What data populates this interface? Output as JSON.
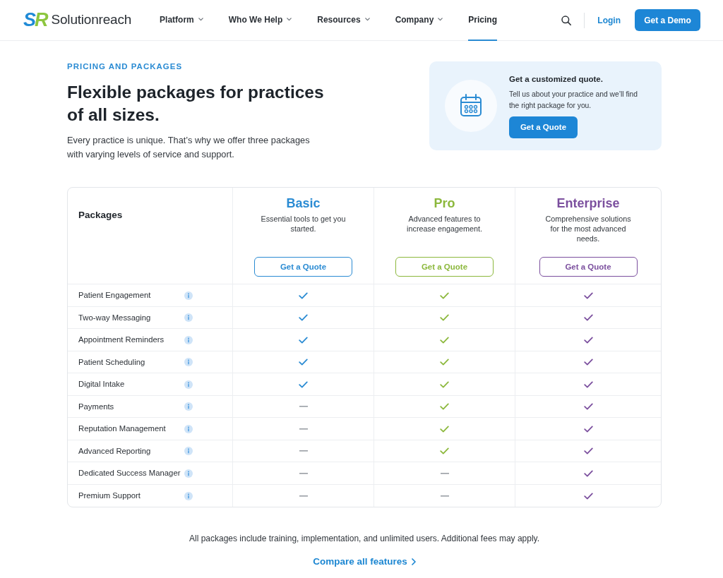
{
  "brand": {
    "mark": [
      "S",
      "R"
    ],
    "name": "Solutionreach"
  },
  "nav": [
    {
      "label": "Platform",
      "dropdown": true,
      "selected": false
    },
    {
      "label": "Who We Help",
      "dropdown": true,
      "selected": false
    },
    {
      "label": "Resources",
      "dropdown": true,
      "selected": false
    },
    {
      "label": "Company",
      "dropdown": true,
      "selected": false
    },
    {
      "label": "Pricing",
      "dropdown": false,
      "selected": true
    }
  ],
  "header_actions": {
    "login": "Login",
    "demo_button": "Get a Demo"
  },
  "hero": {
    "eyebrow": "PRICING AND PACKAGES",
    "title": "Flexible packages for practices of all sizes.",
    "intro": "Every practice is unique. That’s why we offer three packages with varying levels of service and support."
  },
  "quote_card": {
    "title": "Get a customized quote.",
    "text": "Tell us about your practice and we’ll find the right package for you.",
    "button": "Get a Quote"
  },
  "table": {
    "header": "Packages",
    "plans": [
      {
        "name": "Basic",
        "color": "#2a8bd3",
        "description": "Essential tools to get you started.",
        "button": "Get a Quote"
      },
      {
        "name": "Pro",
        "color": "#8cb83c",
        "description": "Advanced features to increase engagement.",
        "button": "Get a Quote"
      },
      {
        "name": "Enterprise",
        "color": "#7b4f9e",
        "description": "Comprehensive solutions for the most advanced needs.",
        "button": "Get a Quote"
      }
    ],
    "features": [
      {
        "name": "Patient Engagement",
        "included": [
          true,
          true,
          true
        ]
      },
      {
        "name": "Two-way Messaging",
        "included": [
          true,
          true,
          true
        ]
      },
      {
        "name": "Appointment Reminders",
        "included": [
          true,
          true,
          true
        ]
      },
      {
        "name": "Patient Scheduling",
        "included": [
          true,
          true,
          true
        ]
      },
      {
        "name": "Digital Intake",
        "included": [
          true,
          true,
          true
        ]
      },
      {
        "name": "Payments",
        "included": [
          false,
          true,
          true
        ]
      },
      {
        "name": "Reputation Management",
        "included": [
          false,
          true,
          true
        ]
      },
      {
        "name": "Advanced Reporting",
        "included": [
          false,
          true,
          true
        ]
      },
      {
        "name": "Dedicated Success Manager",
        "included": [
          false,
          false,
          true
        ]
      },
      {
        "name": "Premium Support",
        "included": [
          false,
          false,
          true
        ]
      }
    ]
  },
  "footer": {
    "note": "All packages include training, implementation, and unlimited users. Additional fees may apply.",
    "link": "Compare all features"
  }
}
